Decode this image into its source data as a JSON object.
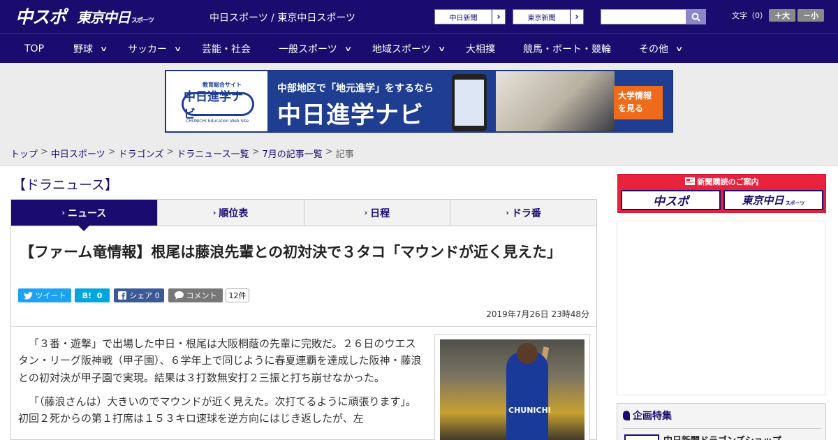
{
  "header": {
    "logo_chuspo": "中スポ",
    "logo_tokyo": "東京中日",
    "logo_tokyo_sub": "スポーツ",
    "site_title": "中日スポーツ / 東京中日スポーツ",
    "ext_links": [
      {
        "label": "中日新聞",
        "arrow": "›"
      },
      {
        "label": "東京新聞",
        "arrow": "›"
      }
    ],
    "search": {
      "placeholder": "",
      "icon": "search-icon"
    },
    "font_size_label": "文字（0）",
    "font_bigger": "＋大",
    "font_smaller": "－小"
  },
  "nav": {
    "items": [
      {
        "label": "TOP",
        "dropdown": false
      },
      {
        "label": "野球",
        "dropdown": true
      },
      {
        "label": "サッカー",
        "dropdown": true
      },
      {
        "label": "芸能・社会",
        "dropdown": false
      },
      {
        "label": "一般スポーツ",
        "dropdown": true
      },
      {
        "label": "地域スポーツ",
        "dropdown": true
      },
      {
        "label": "大相撲",
        "dropdown": false
      },
      {
        "label": "競馬・ボート・競輪",
        "dropdown": false
      },
      {
        "label": "その他",
        "dropdown": true
      }
    ],
    "chevron": "∨"
  },
  "banner": {
    "logo_tag": "教育総合サイト",
    "logo_text": "中日進学ナビ",
    "logo_sub": "CHUNICHI Education Web Site",
    "line1": "中部地区で「地元進学」をするなら",
    "line2": "中日進学ナビ",
    "cta": "大学情報を見る"
  },
  "breadcrumb": {
    "items": [
      "トップ",
      "中日スポーツ",
      "ドラゴンズ",
      "ドラニュース一覧",
      "7月の記事一覧"
    ],
    "current": "記事",
    "separator": ">"
  },
  "section_heading": "【ドラニュース】",
  "tabs": [
    {
      "label": "ニュース",
      "active": true
    },
    {
      "label": "順位表",
      "active": false
    },
    {
      "label": "日程",
      "active": false
    },
    {
      "label": "ドラ番",
      "active": false
    }
  ],
  "tab_chevron": "›",
  "article": {
    "title": "【ファーム竜情報】根尾は藤浪先輩との初対決で３タコ「マウンドが近く見えた」",
    "share": {
      "tweet": "ツイート",
      "hatena_label": "B!",
      "hatena_count": "0",
      "facebook_label": "シェア",
      "facebook_count": "0",
      "comment": "コメント",
      "count": "12件"
    },
    "date": "2019年7月26日 23時48分",
    "paragraphs": [
      "「３番・遊撃」で出場した中日・根尾は大阪桐蔭の先輩に完敗だ。２６日のウエスタン・リーグ阪神戦（甲子園）、６学年上で同じように春夏連覇を達成した阪神・藤浪との初対決が甲子園で実現。結果は３打数無安打２三振と打ち崩せなかった。",
      "「（藤浪さんは）大きいのでマウンドが近く見えた。次打てるように頑張ります」。初回２死からの第１打席は１５３キロ速球を逆方向にはじき返したが、左"
    ],
    "photo_jersey": "CHUNICHI"
  },
  "sidebar": {
    "subscribe_title": "新聞購読のご案内",
    "subscribe_left": "中スポ",
    "subscribe_right": "東京中日",
    "subscribe_right_sub": "スポーツ",
    "feature_title": "企画特集",
    "feature_item": "中日新聞ドラゴンズショップ"
  },
  "colors": {
    "brand": "#1a0c6e",
    "twitter": "#1da1f2",
    "hatena": "#00a4de",
    "facebook": "#3b5998",
    "subscribe_red": "#e8213c",
    "cta_orange": "#ee6b1b"
  }
}
